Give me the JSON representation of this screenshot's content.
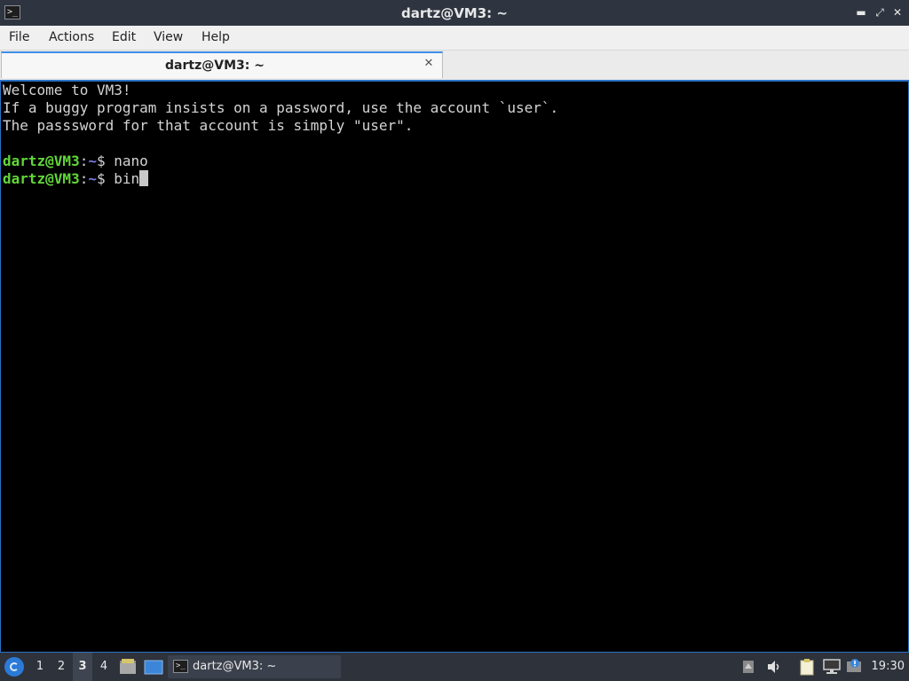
{
  "window": {
    "title": "dartz@VM3: ~",
    "icon": "terminal-icon",
    "controls": [
      "minimize-icon",
      "maximize-icon",
      "close-icon"
    ]
  },
  "menu": {
    "file": "File",
    "actions": "Actions",
    "edit": "Edit",
    "view": "View",
    "help": "Help"
  },
  "tab": {
    "label": "dartz@VM3: ~",
    "close": "✕"
  },
  "terminal": {
    "lines": [
      "Welcome to VM3!",
      "If a buggy program insists on a password, use the account `user`.",
      "The passsword for that account is simply \"user\"."
    ],
    "prompt": {
      "user_host": "dartz@VM3",
      "colon": ":",
      "path": "~",
      "symbol": "$ "
    },
    "commands": [
      "nano",
      "bin"
    ],
    "colors": {
      "user_host": "#61d63a",
      "path": "#7a7ae6",
      "text": "#d4d4d4"
    }
  },
  "taskbar": {
    "desktops": [
      "1",
      "2",
      "3",
      "4"
    ],
    "active_desktop": "3",
    "task_label": "dartz@VM3: ~",
    "clock": "19:30",
    "tray_icons": [
      "trash-icon",
      "volume-icon",
      "clipboard-icon",
      "network-icon",
      "update-icon"
    ]
  }
}
